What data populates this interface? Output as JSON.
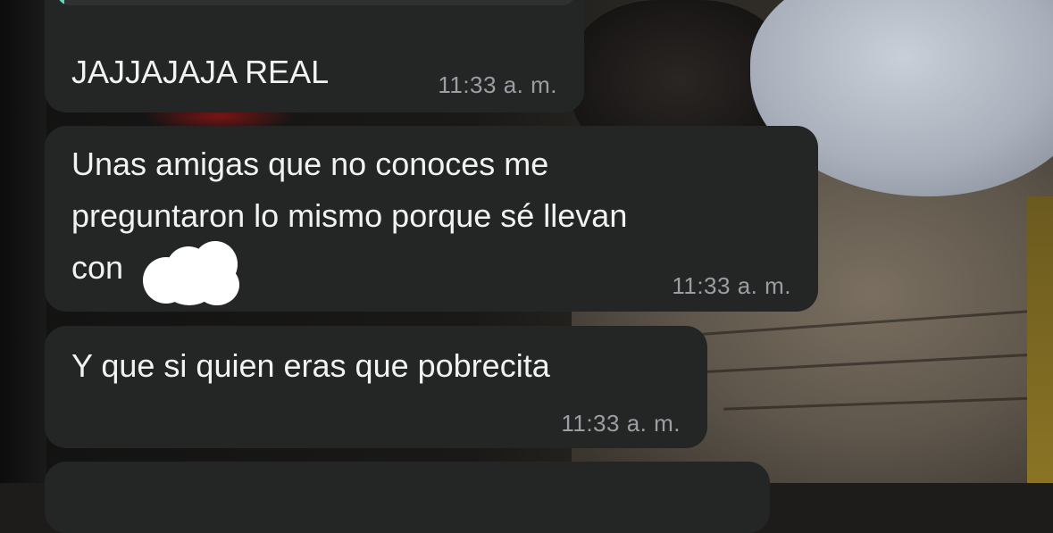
{
  "conversation": {
    "messages": [
      {
        "text": "JAJJAJAJA REAL",
        "time": "11:33 a. m.",
        "has_reply_quote": true
      },
      {
        "text": "Unas amigas que no conoces me\npreguntaron lo mismo porque sé llevan\ncon",
        "time": "11:33 a. m.",
        "redacted_name": true
      },
      {
        "text": "Y que si quien eras que pobrecita",
        "time": "11:33 a. m."
      },
      {
        "text": "",
        "time": ""
      }
    ]
  },
  "colors": {
    "bubble_bg": "#242626",
    "text": "#f2f2f2",
    "timestamp": "#9b9fa3",
    "reply_accent": "#5fd7c5"
  }
}
